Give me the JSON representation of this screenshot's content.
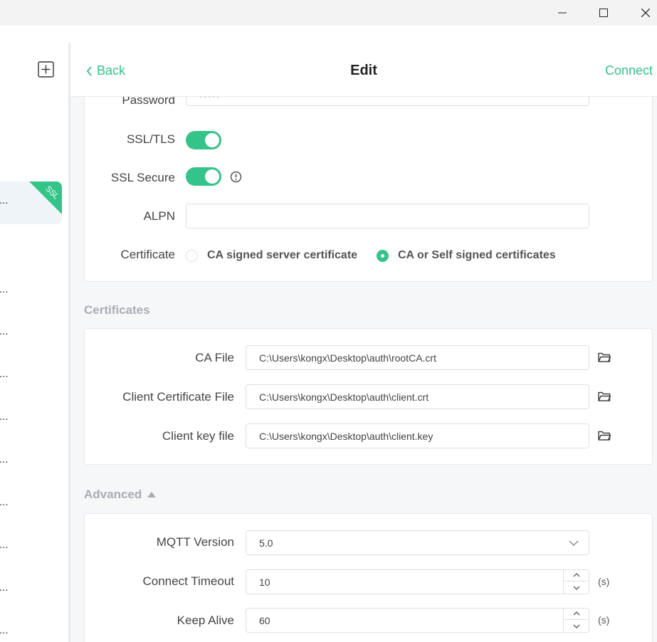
{
  "header": {
    "back_label": "Back",
    "title": "Edit",
    "connect_label": "Connect"
  },
  "sidebar": {
    "active_badge": "SSL",
    "item_ellipsis": "..."
  },
  "general": {
    "password_label": "Password",
    "password_value": "•••••",
    "ssl_tls_label": "SSL/TLS",
    "ssl_tls_on": true,
    "ssl_secure_label": "SSL Secure",
    "ssl_secure_on": true,
    "alpn_label": "ALPN",
    "alpn_value": "",
    "certificate_label": "Certificate",
    "certificate_options": [
      "CA signed server certificate",
      "CA or Self signed certificates"
    ],
    "certificate_selected": "CA or Self signed certificates"
  },
  "certificates": {
    "section_title": "Certificates",
    "ca_file_label": "CA File",
    "ca_file_value": "C:\\Users\\kongx\\Desktop\\auth\\rootCA.crt",
    "client_cert_label": "Client Certificate File",
    "client_cert_value": "C:\\Users\\kongx\\Desktop\\auth\\client.crt",
    "client_key_label": "Client key file",
    "client_key_value": "C:\\Users\\kongx\\Desktop\\auth\\client.key"
  },
  "advanced": {
    "section_title": "Advanced",
    "mqtt_version_label": "MQTT Version",
    "mqtt_version_value": "5.0",
    "connect_timeout_label": "Connect Timeout",
    "connect_timeout_value": "10",
    "keep_alive_label": "Keep Alive",
    "keep_alive_value": "60",
    "unit": "(s)"
  },
  "colors": {
    "accent": "#34c388",
    "section_title": "#a8adb5",
    "background": "#f6f7f9"
  }
}
